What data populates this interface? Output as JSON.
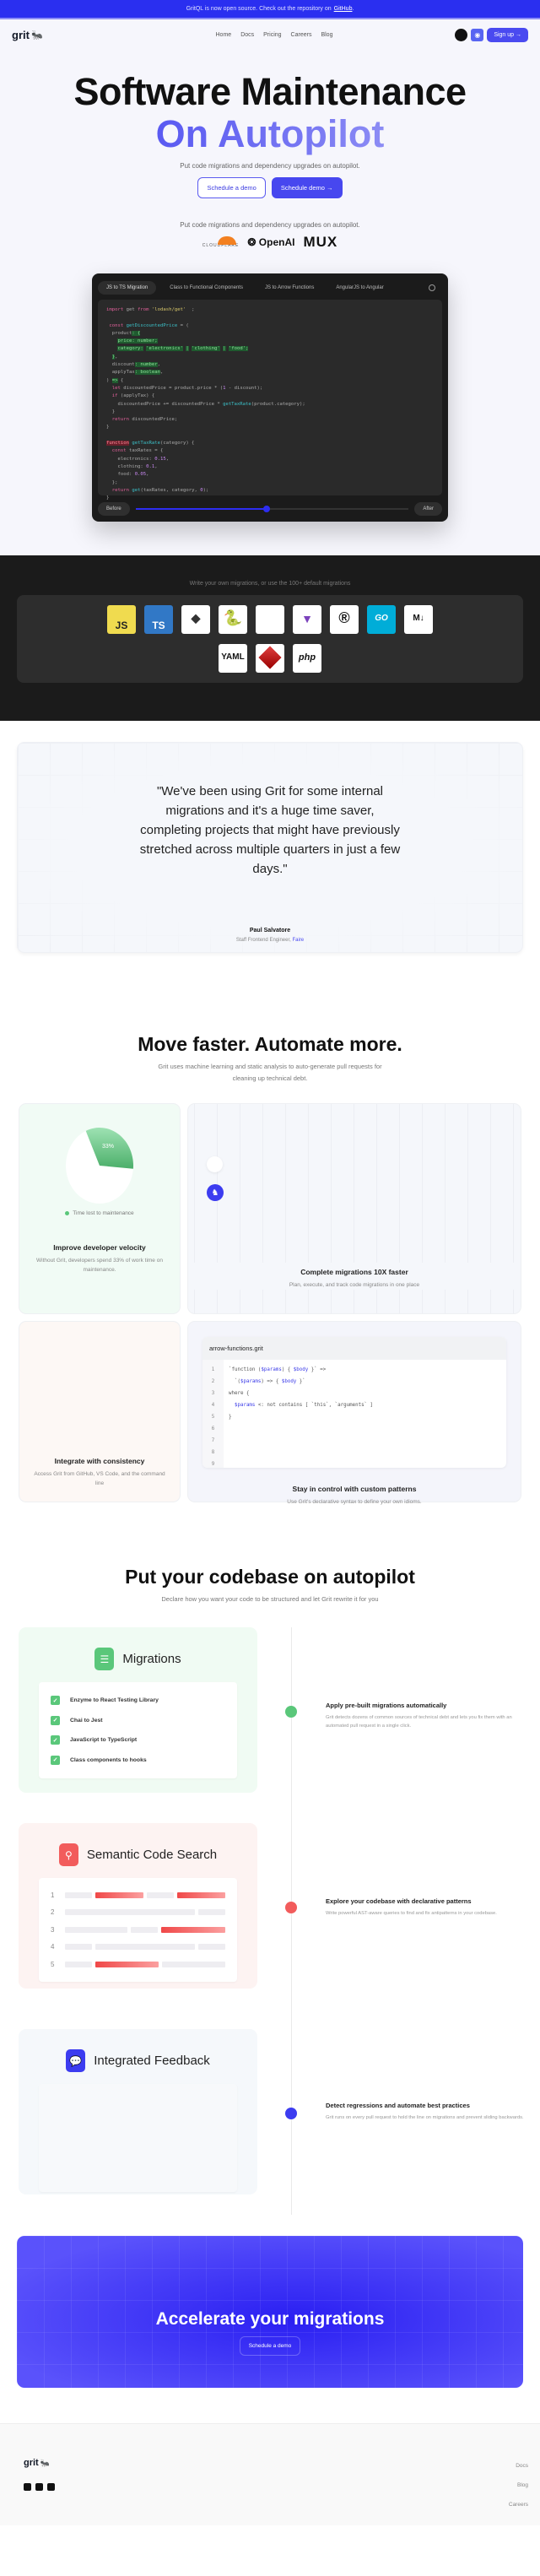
{
  "banner": {
    "text": "GritQL is now open source. Check out the repository on",
    "link": "GitHub",
    "suffix": "."
  },
  "nav": {
    "logo": "grit",
    "links": [
      "Home",
      "Docs",
      "Pricing",
      "Careers",
      "Blog"
    ],
    "signup": "Sign up →"
  },
  "hero": {
    "title_line1": "Software Maintenance",
    "title_line2": "On Autopilot",
    "subtitle": "Put code migrations and dependency upgrades on autopilot.",
    "btn_outline": "Schedule a demo",
    "btn_solid": "Schedule demo →",
    "logos_caption": "Put code migrations and dependency upgrades on autopilot.",
    "logos": [
      "CLOUDFLARE",
      "OpenAI",
      "MUX"
    ]
  },
  "demo": {
    "tabs": [
      "JS to TS Migration",
      "Class to Functional Components",
      "JS to Arrow Functions",
      "AngularJS to Angular"
    ],
    "active_tab": 0,
    "before_label": "Before",
    "after_label": "After",
    "slider_value_pct": 48
  },
  "languages": {
    "caption": "Write your own migrations, or use the 100+ default migrations",
    "items": [
      "JS",
      "TS",
      "Solidity",
      "Python",
      "blank",
      "Terraform",
      "Rust",
      "GO",
      "Markdown",
      "YAML",
      "Ruby",
      "php"
    ]
  },
  "testimonial": {
    "quote": "\"We've been using Grit for some internal migrations and it's a huge time saver, completing projects that might have previously stretched across multiple quarters in just a few days.\"",
    "author": "Paul Salvatore",
    "role": "Staff Frontend Engineer,",
    "company": "Faire"
  },
  "features": {
    "title": "Move faster. Automate more.",
    "subtitle": "Grit uses machine learning and static analysis to auto-generate pull requests for cleaning up technical debt.",
    "cards": [
      {
        "title": "Improve developer velocity",
        "desc": "Without Grit, developers spend 33% of work time on maintenance.",
        "pie_label": "33%",
        "legend": "Time lost to maintenance",
        "pie_value": 33
      },
      {
        "title": "Complete migrations 10X faster",
        "desc": "Plan, execute, and track code migrations in one place"
      },
      {
        "title": "Integrate with consistency",
        "desc": "Access Grit from GitHub, VS Code, and the command line"
      },
      {
        "title": "Stay in control with custom patterns",
        "desc": "Use Grit's declarative syntax to define your own idioms.",
        "filename": "arrow-functions.grit",
        "line_numbers": [
          "1",
          "2",
          "3",
          "4",
          "5",
          "6",
          "7",
          "8",
          "9"
        ]
      }
    ]
  },
  "autopilot": {
    "title": "Put your codebase on autopilot",
    "subtitle": "Declare how you want your code to be structured and let Grit rewrite it for you",
    "migrations": {
      "title": "Migrations",
      "items": [
        "Enzyme to React Testing Library",
        "Chai to Jest",
        "JavaScript to TypeScript",
        "Class components to hooks"
      ]
    },
    "search": {
      "title": "Semantic Code Search",
      "rows": [
        "1",
        "2",
        "3",
        "4",
        "5"
      ]
    },
    "feedback": {
      "title": "Integrated Feedback"
    },
    "steps": [
      {
        "title": "Apply pre-built migrations automatically",
        "desc": "Grit detects dozens of common sources of technical debt and lets you fix them with an automated pull request in a single click.",
        "color": "#5ac77a"
      },
      {
        "title": "Explore your codebase with declarative patterns",
        "desc": "Write powerful AST-aware queries to find and fix antipatterns in your codebase.",
        "color": "#f25c5c"
      },
      {
        "title": "Detect regressions and automate best practices",
        "desc": "Grit runs on every pull request to hold the line on migrations and prevent sliding backwards.",
        "color": "#3c3cf0"
      }
    ]
  },
  "cta": {
    "title": "Accelerate your migrations",
    "button": "Schedule a demo"
  },
  "footer": {
    "logo": "grit",
    "links": [
      "Docs",
      "Blog",
      "Careers"
    ],
    "social": [
      "twitter-icon",
      "linkedin-icon",
      "discord-icon"
    ]
  }
}
